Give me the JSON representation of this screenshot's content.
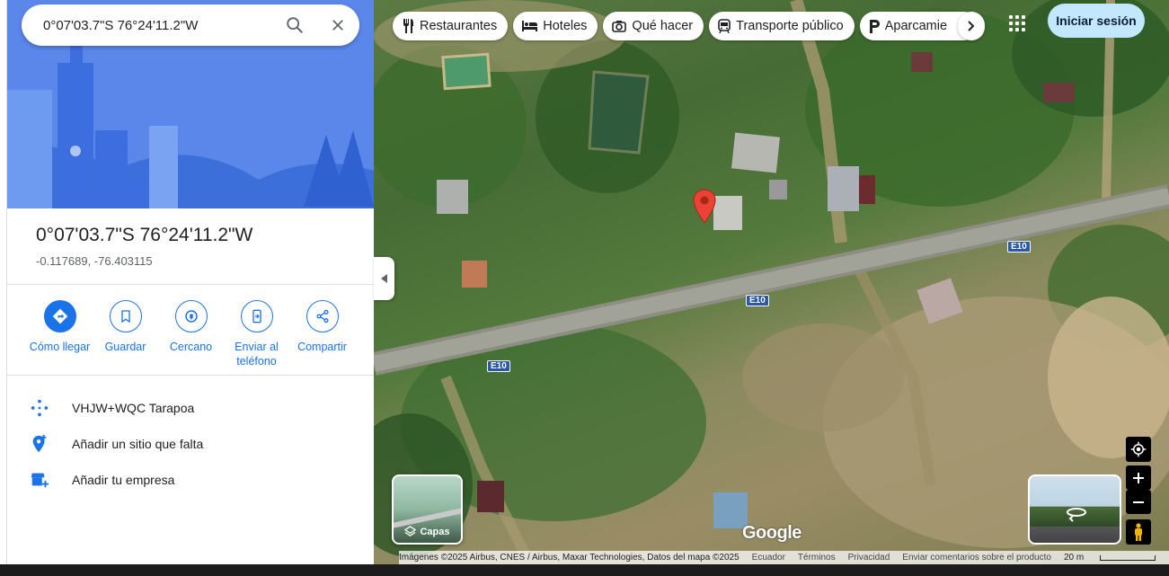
{
  "search": {
    "query": "0°07'03.7\"S 76°24'11.2\"W"
  },
  "place": {
    "title": "0°07'03.7\"S 76°24'11.2\"W",
    "coords": "-0.117689, -76.403115"
  },
  "actions": [
    {
      "label": "Cómo llegar"
    },
    {
      "label": "Guardar"
    },
    {
      "label": "Cercano"
    },
    {
      "label": "Enviar al teléfono"
    },
    {
      "label": "Compartir"
    }
  ],
  "info_rows": [
    {
      "text": "VHJW+WQC Tarapoa"
    },
    {
      "text": "Añadir un sitio que falta"
    },
    {
      "text": "Añadir tu empresa"
    }
  ],
  "chips": [
    {
      "label": "Restaurantes",
      "icon": "restaurant-icon"
    },
    {
      "label": "Hoteles",
      "icon": "hotel-icon"
    },
    {
      "label": "Qué hacer",
      "icon": "camera-icon"
    },
    {
      "label": "Transporte público",
      "icon": "transit-icon"
    },
    {
      "label": "Aparcamie",
      "icon": "parking-icon"
    }
  ],
  "header": {
    "signin_label": "Iniciar sesión"
  },
  "map": {
    "layers_label": "Capas",
    "road_labels": [
      "E10",
      "E10",
      "E10"
    ],
    "logo": "Google",
    "attribution": "Imágenes ©2025 Airbus, CNES / Airbus, Maxar Technologies, Datos del mapa ©2025",
    "links": [
      "Ecuador",
      "Términos",
      "Privacidad",
      "Enviar comentarios sobre el producto"
    ],
    "scale": "20 m"
  },
  "colors": {
    "accent": "#1a73e8",
    "pin": "#ea4335",
    "signin_bg": "#c2e7ff"
  }
}
